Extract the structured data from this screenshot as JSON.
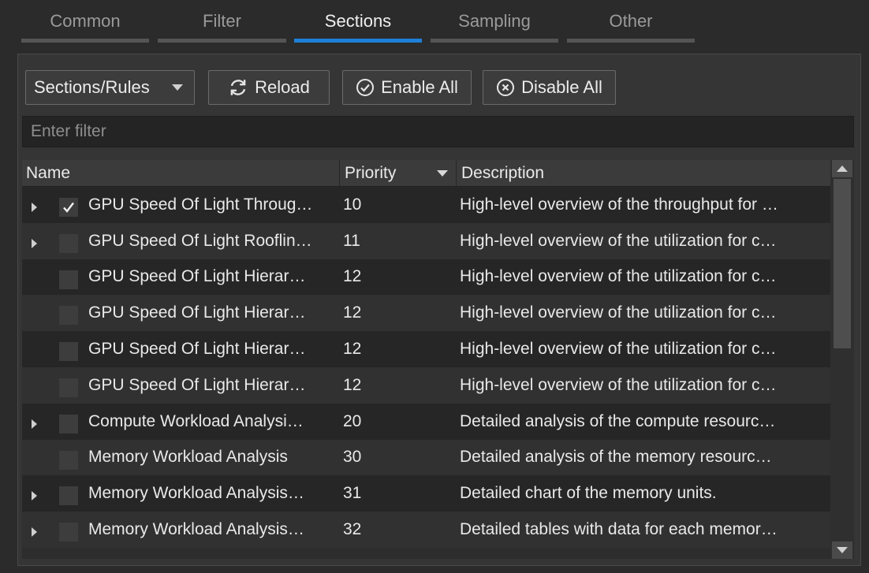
{
  "tabs": [
    {
      "label": "Common",
      "active": false
    },
    {
      "label": "Filter",
      "active": false
    },
    {
      "label": "Sections",
      "active": true
    },
    {
      "label": "Sampling",
      "active": false
    },
    {
      "label": "Other",
      "active": false
    }
  ],
  "toolbar": {
    "mode_select": "Sections/Rules",
    "reload_label": "Reload",
    "enable_all_label": "Enable All",
    "disable_all_label": "Disable All"
  },
  "filter": {
    "placeholder": "Enter filter",
    "value": ""
  },
  "table": {
    "columns": {
      "name": "Name",
      "priority": "Priority",
      "description": "Description"
    },
    "sorted_by": "Priority",
    "rows": [
      {
        "name": "GPU Speed Of Light Throug…",
        "priority": "10",
        "description": "High-level overview of the throughput for …",
        "expandable": true,
        "checked": true
      },
      {
        "name": "GPU Speed Of Light Rooflin…",
        "priority": "11",
        "description": "High-level overview of the utilization for c…",
        "expandable": true,
        "checked": false
      },
      {
        "name": "GPU Speed Of Light Hierar…",
        "priority": "12",
        "description": "High-level overview of the utilization for c…",
        "expandable": false,
        "checked": false
      },
      {
        "name": "GPU Speed Of Light Hierar…",
        "priority": "12",
        "description": "High-level overview of the utilization for c…",
        "expandable": false,
        "checked": false
      },
      {
        "name": "GPU Speed Of Light Hierar…",
        "priority": "12",
        "description": "High-level overview of the utilization for c…",
        "expandable": false,
        "checked": false
      },
      {
        "name": "GPU Speed Of Light Hierar…",
        "priority": "12",
        "description": "High-level overview of the utilization for c…",
        "expandable": false,
        "checked": false
      },
      {
        "name": "Compute Workload Analysi…",
        "priority": "20",
        "description": "Detailed analysis of the compute resourc…",
        "expandable": true,
        "checked": false
      },
      {
        "name": "Memory Workload Analysis",
        "priority": "30",
        "description": "Detailed analysis of the memory resourc…",
        "expandable": false,
        "checked": false
      },
      {
        "name": "Memory Workload Analysis…",
        "priority": "31",
        "description": "Detailed chart of the memory units.",
        "expandable": true,
        "checked": false
      },
      {
        "name": "Memory Workload Analysis…",
        "priority": "32",
        "description": "Detailed tables with data for each memor…",
        "expandable": true,
        "checked": false
      }
    ]
  },
  "colors": {
    "active_tab": "#1e7fd8",
    "background": "#2b2b2b"
  }
}
